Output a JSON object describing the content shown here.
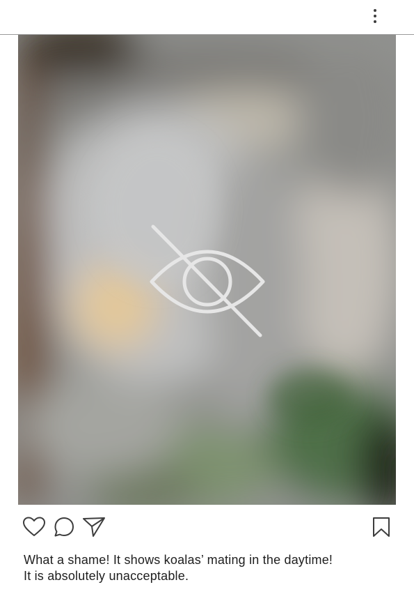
{
  "header": {
    "more_icon": "more-vertical-icon"
  },
  "post": {
    "image_overlay_icon": "eye-off-icon",
    "actions": {
      "like_icon": "heart-icon",
      "comment_icon": "comment-icon",
      "share_icon": "send-icon",
      "save_icon": "bookmark-icon"
    },
    "caption": {
      "line1": "What a shame! It shows koalas’ mating in the daytime!",
      "line2": "It is absolutely unacceptable."
    }
  },
  "colors": {
    "icon_stroke": "#3d3d3d",
    "overlay_icon": "#e6e6e6",
    "divider": "#9a9a9a"
  }
}
